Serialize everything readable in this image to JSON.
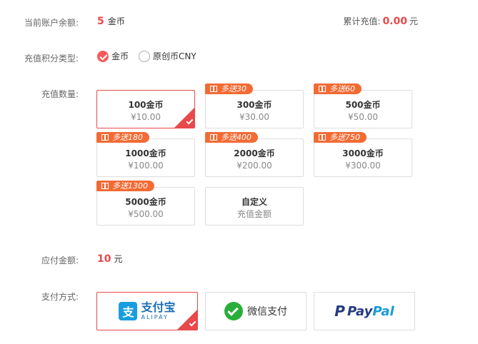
{
  "balance": {
    "label": "当前账户余额:",
    "value": "5",
    "unit": "金币"
  },
  "total": {
    "label": "累计充值:",
    "value": "0.00",
    "unit": "元"
  },
  "type": {
    "label": "充值积分类型:",
    "options": [
      {
        "label": "金币",
        "checked": true
      },
      {
        "label": "原创币CNY",
        "checked": false
      }
    ]
  },
  "quantity": {
    "label": "充值数量:",
    "cards": [
      {
        "title": "100金币",
        "price": "¥10.00",
        "bonus": "",
        "selected": true
      },
      {
        "title": "300金币",
        "price": "¥30.00",
        "bonus": "多送30",
        "selected": false
      },
      {
        "title": "500金币",
        "price": "¥50.00",
        "bonus": "多送60",
        "selected": false
      },
      {
        "title": "1000金币",
        "price": "¥100.00",
        "bonus": "多送180",
        "selected": false
      },
      {
        "title": "2000金币",
        "price": "¥200.00",
        "bonus": "多送400",
        "selected": false
      },
      {
        "title": "3000金币",
        "price": "¥300.00",
        "bonus": "多送750",
        "selected": false
      },
      {
        "title": "5000金币",
        "price": "¥500.00",
        "bonus": "多送1300",
        "selected": false
      },
      {
        "title": "自定义",
        "price": "充值金额",
        "bonus": "",
        "selected": false
      }
    ]
  },
  "pay_amount": {
    "label": "应付金额:",
    "value": "10",
    "unit": "元"
  },
  "pay_method": {
    "label": "支付方式:",
    "alipay": {
      "icon": "支",
      "name": "支付宝",
      "sub": "ALIPAY",
      "selected": true
    },
    "wechat": {
      "name": "微信支付",
      "selected": false
    },
    "paypal": {
      "icon": "P",
      "name_a": "Pay",
      "name_b": "Pal",
      "selected": false
    }
  },
  "colors": {
    "accent": "#e8494a",
    "tag": "#f26b34",
    "alipay": "#1a9de0",
    "wechat": "#2aae3b",
    "paypal_dark": "#253b80",
    "paypal_light": "#179bd7"
  }
}
